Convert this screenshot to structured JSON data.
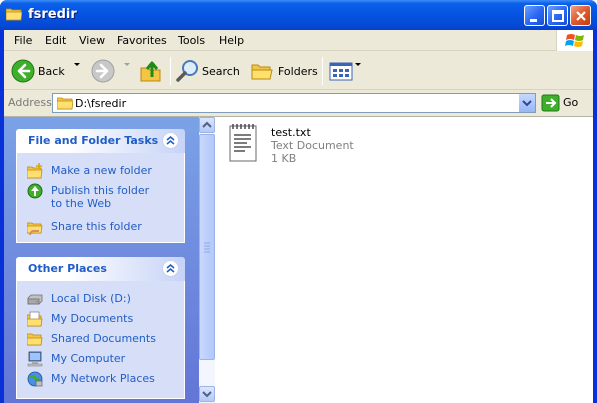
{
  "window": {
    "title": "fsredir"
  },
  "menu": {
    "items": [
      "File",
      "Edit",
      "View",
      "Favorites",
      "Tools",
      "Help"
    ]
  },
  "toolbar": {
    "back_label": "Back",
    "search_label": "Search",
    "folders_label": "Folders"
  },
  "address": {
    "label": "Address",
    "value": "D:\\fsredir",
    "go_label": "Go"
  },
  "tasks": {
    "file_folder": {
      "title": "File and Folder Tasks",
      "items": [
        {
          "label": "Make a new folder",
          "icon": "new-folder-icon"
        },
        {
          "label": "Publish this folder to the Web",
          "icon": "publish-web-icon"
        },
        {
          "label": "Share this folder",
          "icon": "share-folder-icon"
        }
      ]
    },
    "other_places": {
      "title": "Other Places",
      "items": [
        {
          "label": "Local Disk (D:)",
          "icon": "local-disk-icon"
        },
        {
          "label": "My Documents",
          "icon": "my-documents-icon"
        },
        {
          "label": "Shared Documents",
          "icon": "shared-documents-icon"
        },
        {
          "label": "My Computer",
          "icon": "my-computer-icon"
        },
        {
          "label": "My Network Places",
          "icon": "network-places-icon"
        }
      ]
    }
  },
  "files": [
    {
      "name": "test.txt",
      "type": "Text Document",
      "size": "1 KB"
    }
  ],
  "colors": {
    "title_bar": "#0553e0",
    "task_link": "#215dc6",
    "task_pane": "#7ba2e7"
  }
}
